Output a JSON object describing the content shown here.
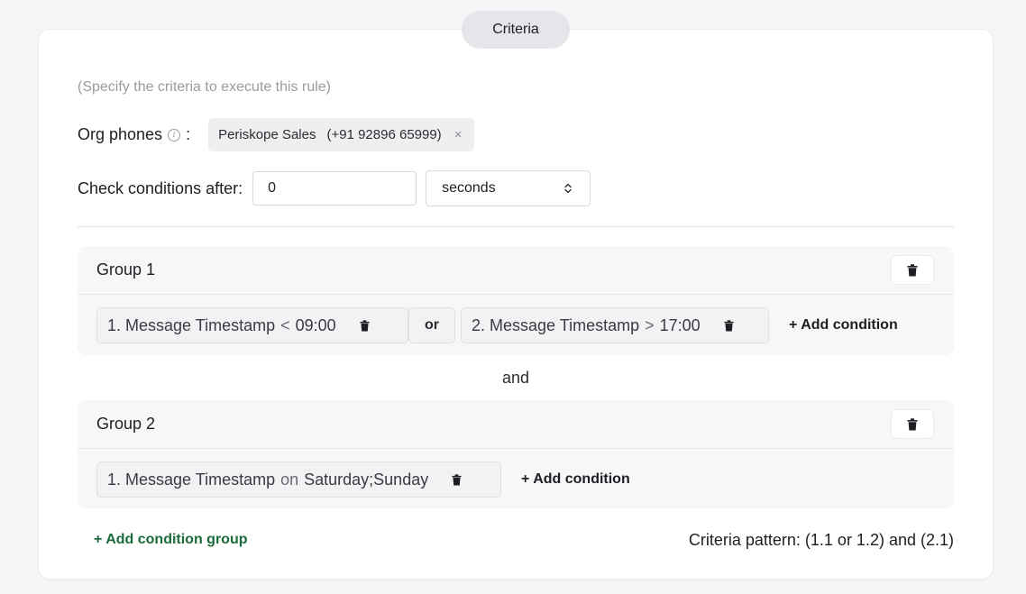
{
  "section_title": "Criteria",
  "hint": "(Specify the criteria to execute this rule)",
  "org_phones": {
    "label": "Org phones",
    "colon": ":",
    "info_icon": "info-icon",
    "tag_name": "Periskope Sales",
    "tag_number": "(+91 92896 65999)",
    "remove_glyph": "×"
  },
  "check_conditions": {
    "label": "Check conditions after:",
    "value": "0",
    "unit": "seconds"
  },
  "groups": [
    {
      "title": "Group 1",
      "conditions": [
        {
          "index": "1.",
          "field": "Message Timestamp",
          "operator": "<",
          "value": "09:00"
        },
        {
          "index": "2.",
          "field": "Message Timestamp",
          "operator": ">",
          "value": "17:00"
        }
      ],
      "joiner": "or",
      "add_label": "+ Add condition"
    },
    {
      "title": "Group 2",
      "conditions": [
        {
          "index": "1.",
          "field": "Message Timestamp",
          "operator": "on",
          "value": "Saturday;Sunday"
        }
      ],
      "add_label": "+ Add condition"
    }
  ],
  "group_joiner": "and",
  "add_group_label": "+ Add condition group",
  "pattern_text": "Criteria pattern: (1.1 or 1.2) and (2.1)",
  "colors": {
    "accent_green": "#1b6b3a",
    "pill_bg": "#e6e6ea",
    "group_bg": "#f7f7f9"
  }
}
